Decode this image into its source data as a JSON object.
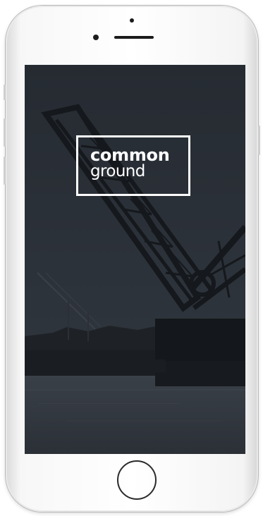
{
  "app": {
    "logo": {
      "line1": "common",
      "line2": "ground"
    }
  },
  "device": {
    "model": "phone",
    "home_button_icon": "circle-home-button"
  },
  "colors": {
    "screen_background": "#2a2f36",
    "logo": "#ffffff",
    "device_frame": "#f5f5f5"
  }
}
